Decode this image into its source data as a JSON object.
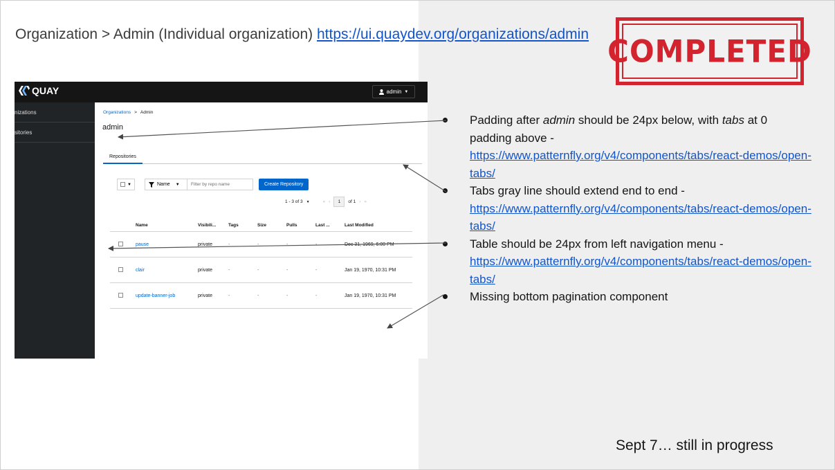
{
  "slide": {
    "title_prefix": "Organization > Admin (Individual organization) ",
    "title_link": "https://ui.quaydev.org/organizations/admin",
    "stamp": "COMPLETED",
    "footer": "Sept 7… still in progress"
  },
  "app": {
    "logo_text": "QUAY",
    "user_menu": "admin",
    "sidebar": [
      "nizations",
      "sitories"
    ],
    "breadcrumb": {
      "parent": "Organizations",
      "separator": ">",
      "current": "Admin"
    },
    "page_title": "admin",
    "tab": "Repositories",
    "toolbar": {
      "filter_label": "Name",
      "filter_placeholder": "Filter by repo name",
      "create_button": "Create Repository"
    },
    "pagination": {
      "range": "1 - 3 of 3",
      "page": "1",
      "of": "of 1"
    },
    "table": {
      "headers": [
        "Name",
        "Visibili...",
        "Tags",
        "Size",
        "Pulls",
        "Last ...",
        "Last Modified"
      ],
      "rows": [
        {
          "name": "pause",
          "visibility": "private",
          "tags": "-",
          "size": "-",
          "pulls": "-",
          "last": "-",
          "modified": "Dec 31, 1969, 6:00 PM"
        },
        {
          "name": "clair",
          "visibility": "private",
          "tags": "-",
          "size": "-",
          "pulls": "-",
          "last": "-",
          "modified": "Jan 19, 1970, 10:31 PM"
        },
        {
          "name": "update-banner-job",
          "visibility": "private",
          "tags": "-",
          "size": "-",
          "pulls": "-",
          "last": "-",
          "modified": "Jan 19, 1970, 10:31 PM"
        }
      ]
    }
  },
  "notes": [
    {
      "pre": "Padding after ",
      "em1": "admin",
      "mid": " should be 24px below, with ",
      "em2": "tabs",
      "post": " at 0 padding above -",
      "link": "https://www.patternfly.org/v4/components/tabs/react-demos/open-tabs/"
    },
    {
      "text": "Tabs gray line should extend end to end -",
      "link": "https://www.patternfly.org/v4/components/tabs/react-demos/open-tabs/"
    },
    {
      "text": "Table should be 24px from left navigation menu -",
      "link": "https://www.patternfly.org/v4/components/tabs/react-demos/open-tabs/"
    },
    {
      "text": "Missing bottom pagination component"
    }
  ]
}
